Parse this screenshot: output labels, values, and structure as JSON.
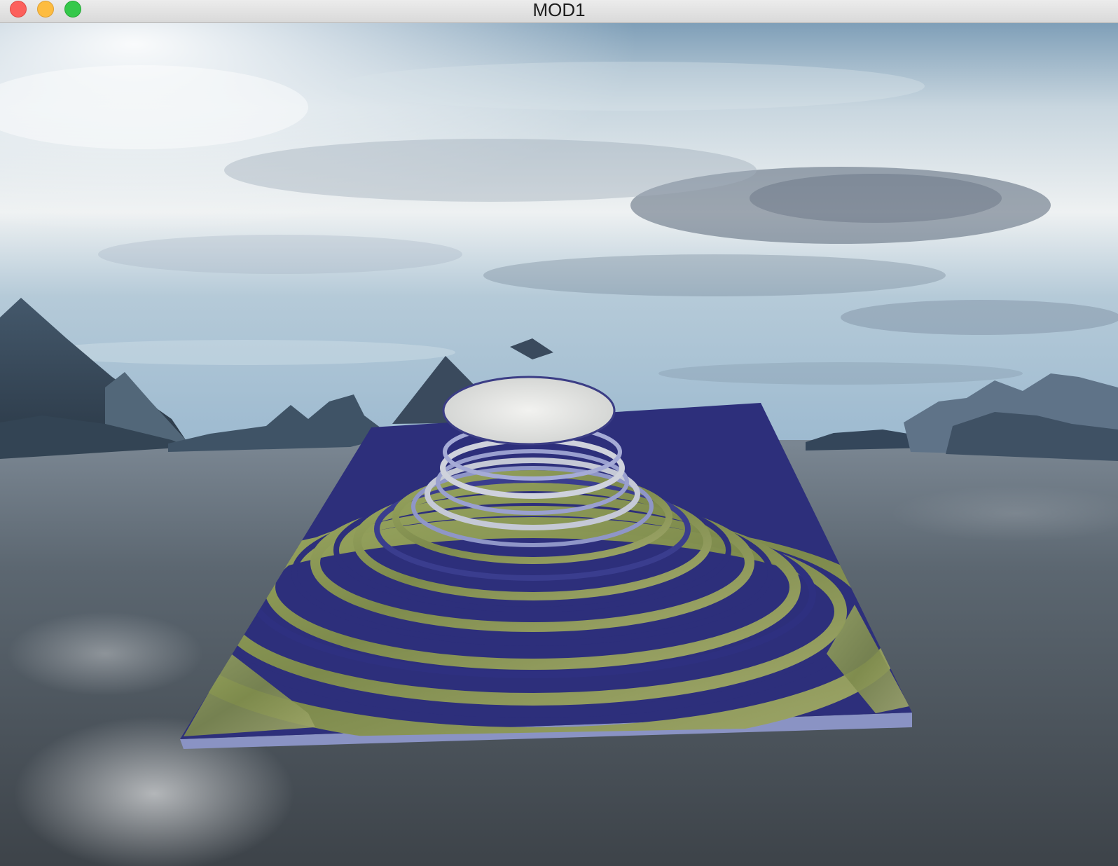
{
  "window": {
    "title": "MOD1"
  },
  "scene": {
    "description_icon": "3d-terrain-render-icon",
    "colors": {
      "sky_top": "#8fb2cc",
      "sky_haze": "#eef2f3",
      "water": "#5d6770",
      "terrain_water": "#2e307a",
      "terrain_grass": "#8d9b5a",
      "snow_cap": "#e6e7e4",
      "mountains": "#3c4f64"
    }
  }
}
